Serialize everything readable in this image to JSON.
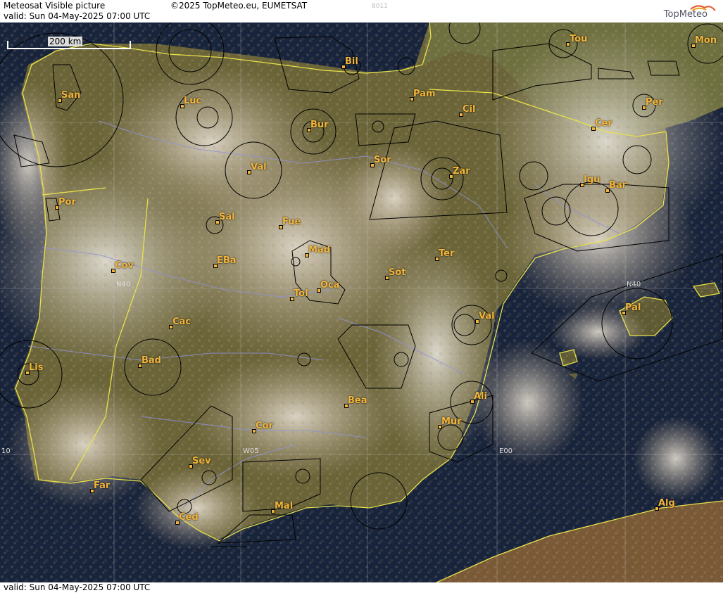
{
  "header": {
    "title": "Meteosat Visible picture",
    "copyright": "©2025 TopMeteo.eu, EUMETSAT",
    "code": "8011",
    "valid": "valid:  Sun  04-May-2025  07:00 UTC",
    "logo": "TopMeteo"
  },
  "footer": {
    "valid": "valid:  Sun  04-May-2025  07:00 UTC"
  },
  "scale": {
    "label": "200 km"
  },
  "grid_labels": {
    "n40_west": "N40",
    "n40_east": "N40",
    "w05": "W05",
    "e00": "E00",
    "w10": "10"
  },
  "cities": [
    {
      "id": "san",
      "label": "San"
    },
    {
      "id": "luc",
      "label": "Luc"
    },
    {
      "id": "bil",
      "label": "Bil"
    },
    {
      "id": "tou",
      "label": "Tou"
    },
    {
      "id": "mon",
      "label": "Mon"
    },
    {
      "id": "pam",
      "label": "Pam"
    },
    {
      "id": "cil",
      "label": "Cil"
    },
    {
      "id": "per",
      "label": "Per"
    },
    {
      "id": "bur",
      "label": "Bur"
    },
    {
      "id": "cer",
      "label": "Cer"
    },
    {
      "id": "val1",
      "label": "Val"
    },
    {
      "id": "sor",
      "label": "Sor"
    },
    {
      "id": "zar",
      "label": "Zar"
    },
    {
      "id": "igu",
      "label": "Igu"
    },
    {
      "id": "bar",
      "label": "Bar"
    },
    {
      "id": "por",
      "label": "Por"
    },
    {
      "id": "sal",
      "label": "Sal"
    },
    {
      "id": "fue",
      "label": "Fue"
    },
    {
      "id": "mad",
      "label": "Mad"
    },
    {
      "id": "cov",
      "label": "Cov"
    },
    {
      "id": "eba",
      "label": "EBa"
    },
    {
      "id": "ter",
      "label": "Ter"
    },
    {
      "id": "sot",
      "label": "Sot"
    },
    {
      "id": "tol",
      "label": "Tol"
    },
    {
      "id": "oca",
      "label": "Oca"
    },
    {
      "id": "pal",
      "label": "Pal"
    },
    {
      "id": "cac",
      "label": "Cac"
    },
    {
      "id": "val2",
      "label": "Val"
    },
    {
      "id": "lis",
      "label": "Lis"
    },
    {
      "id": "bad",
      "label": "Bad"
    },
    {
      "id": "ali",
      "label": "Ali"
    },
    {
      "id": "bea",
      "label": "Bea"
    },
    {
      "id": "mur",
      "label": "Mur"
    },
    {
      "id": "cor",
      "label": "Cor"
    },
    {
      "id": "sev",
      "label": "Sev"
    },
    {
      "id": "far",
      "label": "Far"
    },
    {
      "id": "mal",
      "label": "Mal"
    },
    {
      "id": "alg",
      "label": "Alg"
    },
    {
      "id": "ced",
      "label": "Ced"
    }
  ],
  "colors": {
    "coast": "#e8e24a",
    "sea": "#14203a",
    "land": "#5a5a2c",
    "cloud": "#d9cfc0",
    "city": "#f2b53a",
    "airspace": "#000000",
    "rivers": "#8f92d8"
  }
}
